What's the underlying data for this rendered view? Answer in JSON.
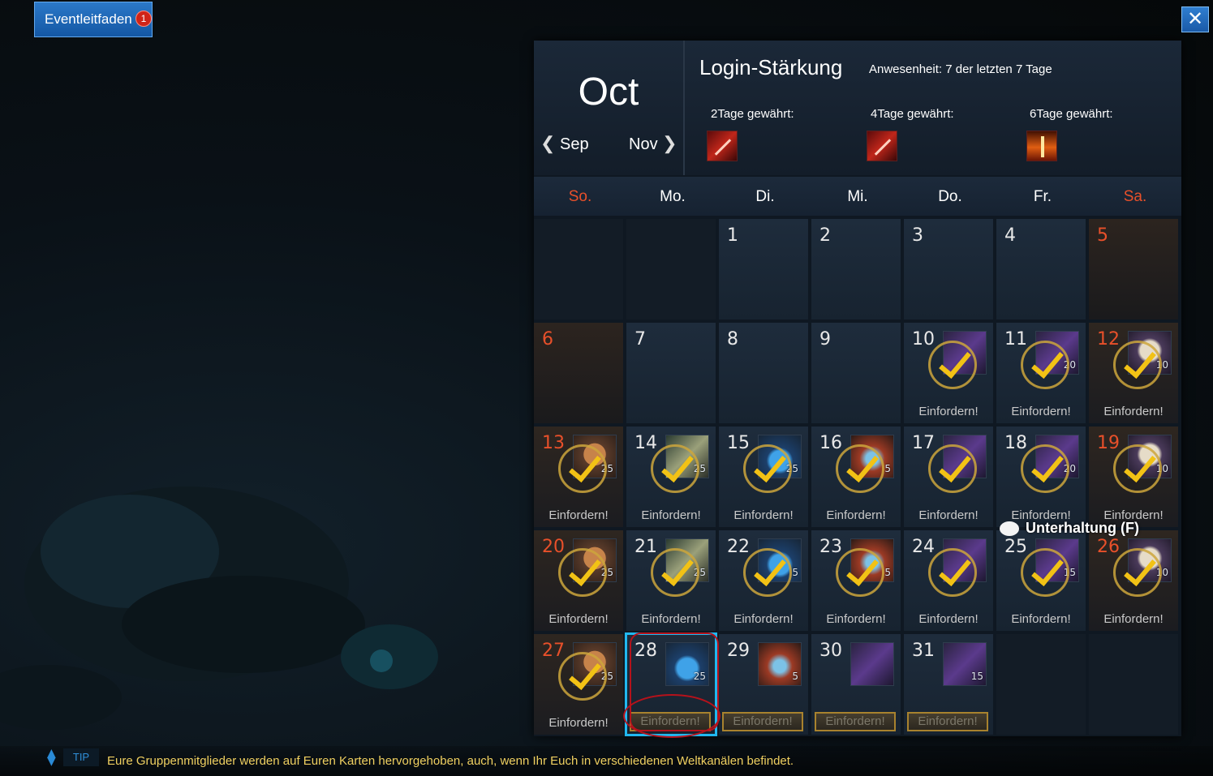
{
  "topbar": {
    "event_button": "Eventleitfaden",
    "event_badge": "1",
    "close": "✕"
  },
  "calendar": {
    "month": "Oct",
    "prev_label": "Sep",
    "next_label": "Nov",
    "title": "Login-Stärkung",
    "attendance": "Anwesenheit: 7 der letzten 7 Tage",
    "rewards": [
      {
        "label": "2Tage gewährt:",
        "icon": "spear-icon"
      },
      {
        "label": "4Tage gewährt:",
        "icon": "blade-icon"
      },
      {
        "label": "6Tage gewährt:",
        "icon": "fire-sword-icon"
      }
    ],
    "weekdays": [
      "So.",
      "Mo.",
      "Di.",
      "Mi.",
      "Do.",
      "Fr.",
      "Sa."
    ],
    "claim_label": "Einfordern!",
    "days": [
      {
        "day": ""
      },
      {
        "day": ""
      },
      {
        "day": "1"
      },
      {
        "day": "2"
      },
      {
        "day": "3"
      },
      {
        "day": "4"
      },
      {
        "day": "5"
      },
      {
        "day": "6"
      },
      {
        "day": "7"
      },
      {
        "day": "8"
      },
      {
        "day": "9"
      },
      {
        "day": "10",
        "item": "potion-purple-icon",
        "qty": "",
        "state": "claimed"
      },
      {
        "day": "11",
        "item": "potion-purple-icon",
        "qty": "20",
        "state": "claimed"
      },
      {
        "day": "12",
        "item": "panda-icon",
        "qty": "10",
        "state": "claimed"
      },
      {
        "day": "13",
        "item": "bear-icon",
        "qty": "25",
        "state": "claimed"
      },
      {
        "day": "14",
        "item": "horn-icon",
        "qty": "25",
        "state": "claimed"
      },
      {
        "day": "15",
        "item": "potion-blue-icon",
        "qty": "25",
        "state": "claimed"
      },
      {
        "day": "16",
        "item": "potion-red-icon",
        "qty": "5",
        "state": "claimed"
      },
      {
        "day": "17",
        "item": "potion-purple-icon",
        "qty": "",
        "state": "claimed"
      },
      {
        "day": "18",
        "item": "potion-purple-icon",
        "qty": "20",
        "state": "claimed"
      },
      {
        "day": "19",
        "item": "panda-icon",
        "qty": "10",
        "state": "claimed"
      },
      {
        "day": "20",
        "item": "bear-icon",
        "qty": "25",
        "state": "claimed"
      },
      {
        "day": "21",
        "item": "horn-icon",
        "qty": "25",
        "state": "claimed"
      },
      {
        "day": "22",
        "item": "potion-blue-icon",
        "qty": "5",
        "state": "claimed"
      },
      {
        "day": "23",
        "item": "potion-red-icon",
        "qty": "5",
        "state": "claimed"
      },
      {
        "day": "24",
        "item": "potion-purple-icon",
        "qty": "",
        "state": "claimed"
      },
      {
        "day": "25",
        "item": "potion-purple-icon",
        "qty": "15",
        "state": "claimed"
      },
      {
        "day": "26",
        "item": "panda-icon",
        "qty": "10",
        "state": "claimed"
      },
      {
        "day": "27",
        "item": "bear-icon",
        "qty": "25",
        "state": "claimed"
      },
      {
        "day": "28",
        "item": "potion-blue-icon",
        "qty": "25",
        "state": "available"
      },
      {
        "day": "29",
        "item": "potion-red-icon",
        "qty": "5",
        "state": "available"
      },
      {
        "day": "30",
        "item": "potion-purple-icon",
        "qty": "",
        "state": "available"
      },
      {
        "day": "31",
        "item": "potion-purple-icon",
        "qty": "15",
        "state": "available"
      },
      {
        "day": ""
      },
      {
        "day": ""
      }
    ]
  },
  "chat": {
    "label": "Unterhaltung (F)"
  },
  "tip": {
    "tag": "TIP",
    "text": "Eure Gruppenmitglieder werden auf Euren Karten hervorgehoben, auch, wenn Ihr Euch in verschiedenen Weltkanälen befindet."
  },
  "colors": {
    "weekend": "#e8502a",
    "accent": "#21b8f0",
    "tip_text": "#f0d060",
    "check": "#f2c215"
  }
}
